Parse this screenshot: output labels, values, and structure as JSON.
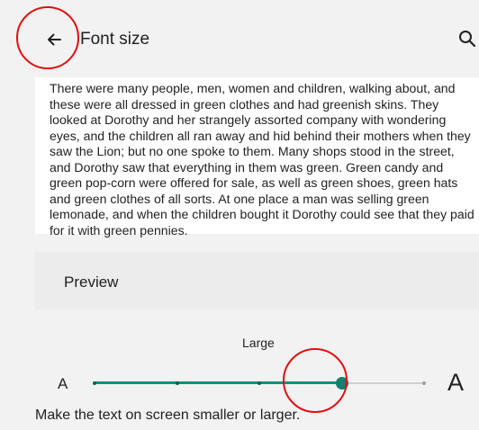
{
  "header": {
    "title": "Font size",
    "back_icon": "arrow-back-icon",
    "search_icon": "search-icon"
  },
  "sample": {
    "text": "There were many people, men, women and children, walking about, and these were all dressed in green clothes and had greenish skins. They looked at Dorothy and her strangely assorted company with wondering eyes, and the children all ran away and hid behind their mothers when they saw the Lion; but no one spoke to them. Many shops stood in the street, and Dorothy saw that everything in them was green. Green candy and green pop-corn were offered for sale, as well as green shoes, green hats and green clothes of all sorts. At one place a man was selling green lemonade, and when the children bought it Dorothy could see that they paid for it with green pennies."
  },
  "preview": {
    "label": "Preview"
  },
  "font_size": {
    "current_label": "Large",
    "small_glyph": "A",
    "large_glyph": "A",
    "steps": 5,
    "current_step": 3,
    "description": "Make the text on screen smaller or larger."
  },
  "colors": {
    "accent": "#1a8c7c",
    "annotation": "#e01010"
  }
}
